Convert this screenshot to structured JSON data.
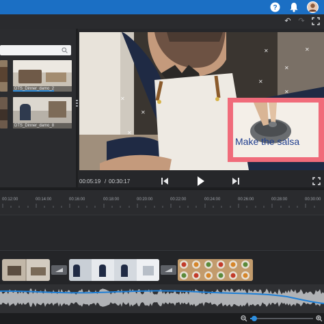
{
  "topbar": {
    "accent_color": "#1b6fc4",
    "icons": [
      "help-icon",
      "bell-icon",
      "user-avatar"
    ]
  },
  "toolbar": {
    "icons": [
      "undo-icon",
      "redo-icon",
      "fullscreen-icon"
    ]
  },
  "library": {
    "search_placeholder": "",
    "items": [
      {
        "label": "DTS_Dinner_damo_2"
      },
      {
        "label": "DTS_Dinner_damo_8"
      }
    ]
  },
  "preview": {
    "overlay_title": "Make the salsa",
    "overlay_border_color": "#f06b7a",
    "overlay_text_color": "#1f3e8f",
    "current_time": "00:05:19",
    "separator": "/",
    "total_time": "00:30:17"
  },
  "timeline": {
    "ticks": [
      "00:12:00",
      "00:14:00",
      "00:16:00",
      "00:18:00",
      "00:20:00",
      "00:22:00",
      "00:24:00",
      "00:26:00",
      "00:28:00",
      "00:30:00"
    ],
    "waveform_color": "#c7c9cc",
    "volume_line_color": "#1e7fd6"
  },
  "zoom": {
    "level": 0.04
  }
}
